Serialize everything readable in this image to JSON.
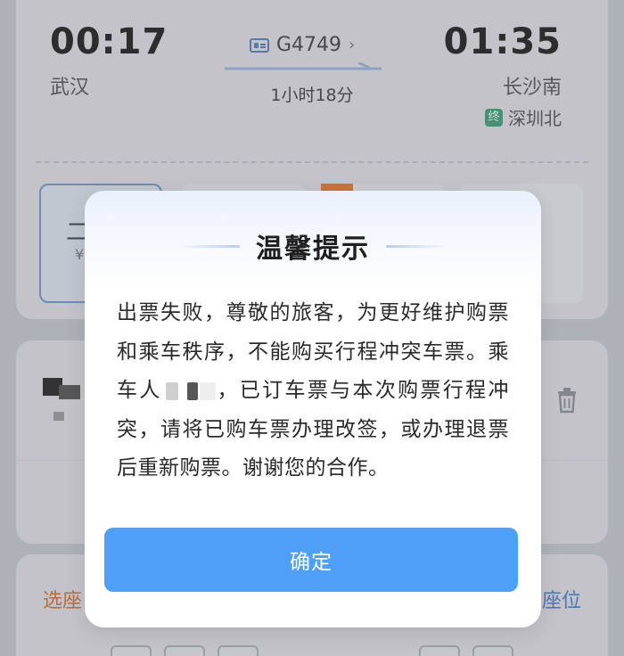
{
  "train": {
    "departure_time": "00:17",
    "departure_station": "武汉",
    "arrival_time": "01:35",
    "arrival_station": "长沙南",
    "train_number": "G4749",
    "train_number_chevron": "›",
    "duration": "1小时18分",
    "terminal_badge": "终",
    "terminal_station": "深圳北"
  },
  "seat_tabs": {
    "first_glyph": "二",
    "first_sub": "¥"
  },
  "seat_section": {
    "select_label": "选座",
    "right_label": "座位"
  },
  "dialog": {
    "title": "温馨提示",
    "message_part1": "出票失败，尊敬的旅客，为更好维护购票和乘车秩序，不能购买行程冲突车票。乘车人",
    "message_part2": "，已订车票与本次购票行程冲突，请将已购车票办理改签，或办理退票后重新购票。谢谢您的合作。",
    "confirm_label": "确定"
  },
  "colors": {
    "primary_button": "#4da0f5",
    "accent_orange": "#d8804a",
    "accent_blue": "#5a8ed0",
    "terminal_badge": "#4fae86"
  },
  "icons": {
    "train_number": "train-ticket-icon",
    "delete": "trash-icon",
    "arrow": "route-arrow-icon"
  }
}
